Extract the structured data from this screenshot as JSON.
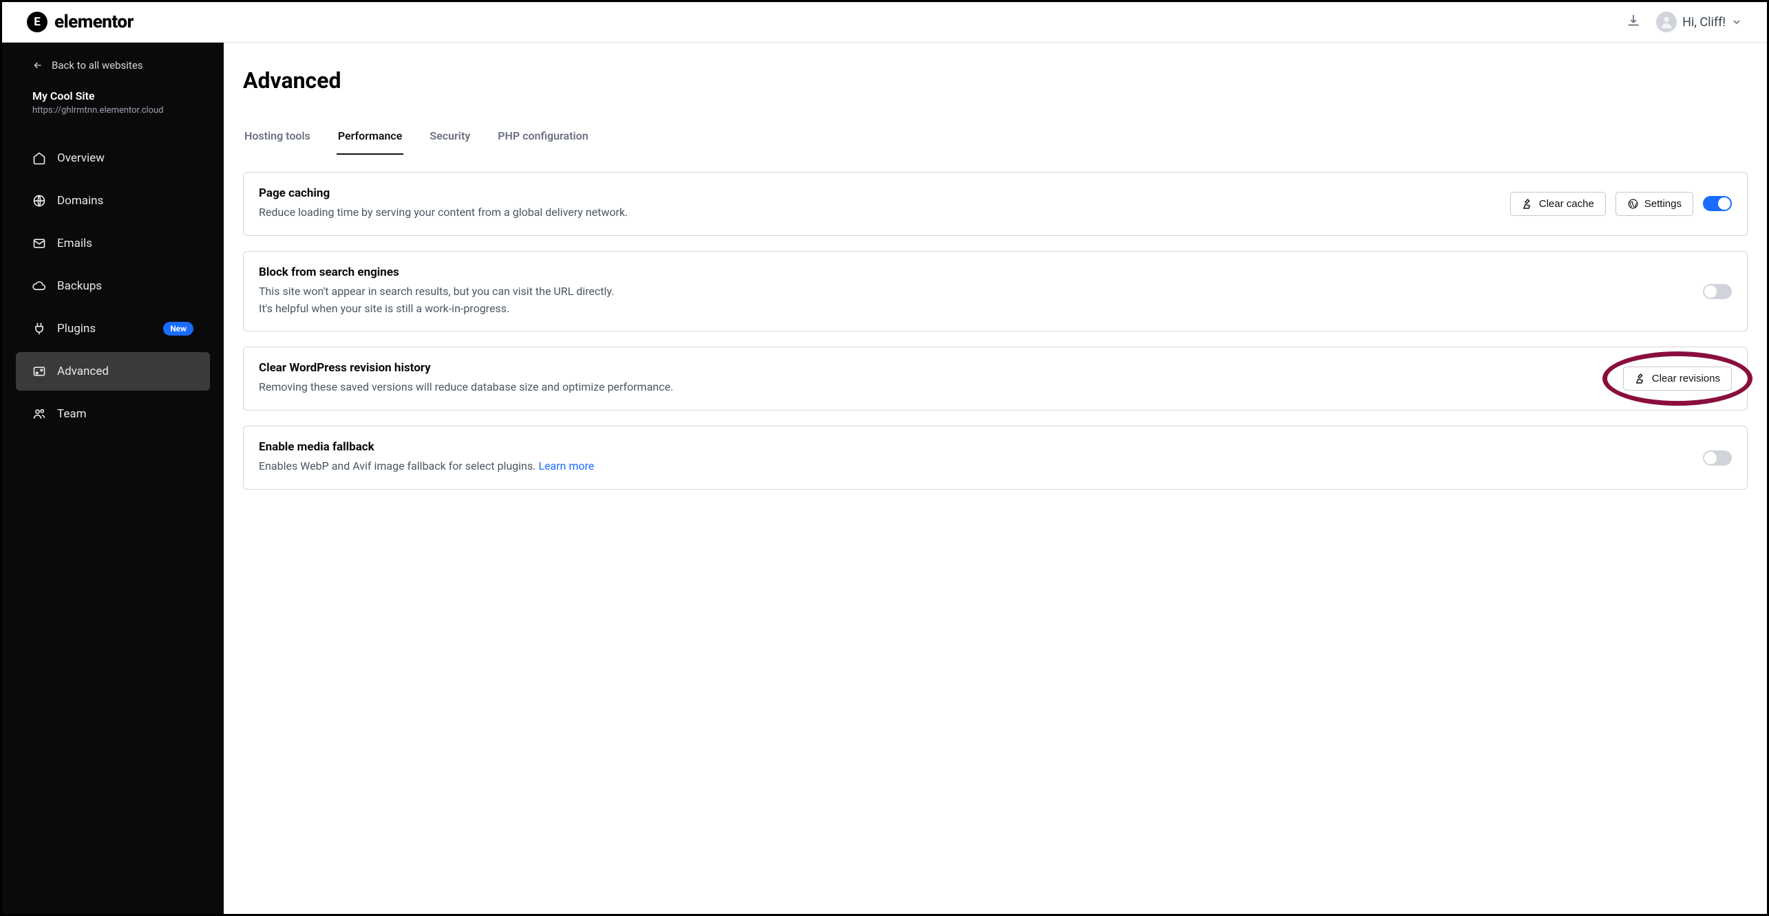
{
  "brand": {
    "name": "elementor",
    "mark": "E"
  },
  "topbar": {
    "greeting": "Hi, Cliff!"
  },
  "sidebar": {
    "back_label": "Back to all websites",
    "site_name": "My Cool Site",
    "site_url": "https://ghlrmtnn.elementor.cloud",
    "items": [
      {
        "label": "Overview",
        "icon": "home"
      },
      {
        "label": "Domains",
        "icon": "globe"
      },
      {
        "label": "Emails",
        "icon": "mail"
      },
      {
        "label": "Backups",
        "icon": "cloud"
      },
      {
        "label": "Plugins",
        "icon": "plug",
        "badge": "New"
      },
      {
        "label": "Advanced",
        "icon": "sliders",
        "active": true
      },
      {
        "label": "Team",
        "icon": "users"
      }
    ]
  },
  "page": {
    "title": "Advanced"
  },
  "tabs": [
    {
      "label": "Hosting tools"
    },
    {
      "label": "Performance",
      "active": true
    },
    {
      "label": "Security"
    },
    {
      "label": "PHP configuration"
    }
  ],
  "cards": {
    "pageCaching": {
      "title": "Page caching",
      "desc": "Reduce loading time by serving your content from a global delivery network.",
      "clear_cache_label": "Clear cache",
      "settings_label": "Settings",
      "toggle_on": true
    },
    "blockSearch": {
      "title": "Block from search engines",
      "desc_line1": "This site won't appear in search results, but you can visit the URL directly.",
      "desc_line2": "It's helpful when your site is still a work-in-progress.",
      "toggle_on": false
    },
    "clearRevisions": {
      "title": "Clear WordPress revision history",
      "desc": "Removing these saved versions will reduce database size and optimize performance.",
      "button_label": "Clear revisions"
    },
    "mediaFallback": {
      "title": "Enable media fallback",
      "desc_prefix": "Enables WebP and Avif image fallback for select plugins. ",
      "learn_more": "Learn more",
      "toggle_on": false
    }
  }
}
